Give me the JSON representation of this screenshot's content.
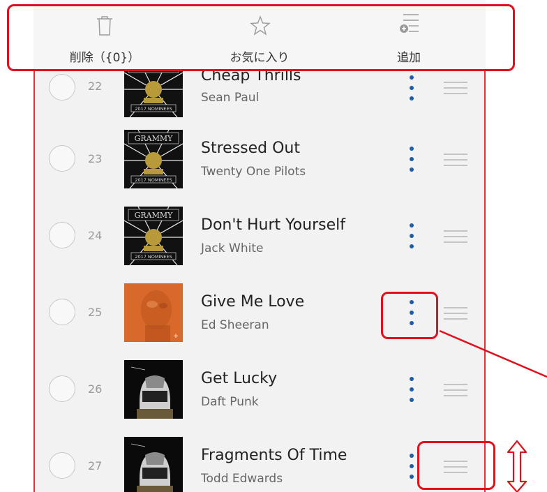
{
  "toolbar": {
    "delete_label": "削除（{0}）",
    "favorite_label": "お気に入り",
    "add_label": "追加"
  },
  "tracks": [
    {
      "number": "22",
      "title": "Cheap Thrills",
      "artist": "Sean Paul",
      "art": "grammy"
    },
    {
      "number": "23",
      "title": "Stressed Out",
      "artist": "Twenty One Pilots",
      "art": "grammy"
    },
    {
      "number": "24",
      "title": "Don't Hurt Yourself",
      "artist": "Jack White",
      "art": "grammy"
    },
    {
      "number": "25",
      "title": "Give Me Love",
      "artist": "Ed Sheeran",
      "art": "orange"
    },
    {
      "number": "26",
      "title": "Get Lucky",
      "artist": "Daft Punk",
      "art": "daftpunk"
    },
    {
      "number": "27",
      "title": "Fragments Of Time",
      "artist": "Todd Edwards",
      "art": "daftpunk"
    }
  ],
  "art_labels": {
    "grammy": "GRAMMY",
    "nominees": "2017 NOMINEES"
  },
  "colors": {
    "accent_blue": "#1e5ba8",
    "annotation_red": "#e0101c",
    "orange_art": "#d9692a"
  }
}
